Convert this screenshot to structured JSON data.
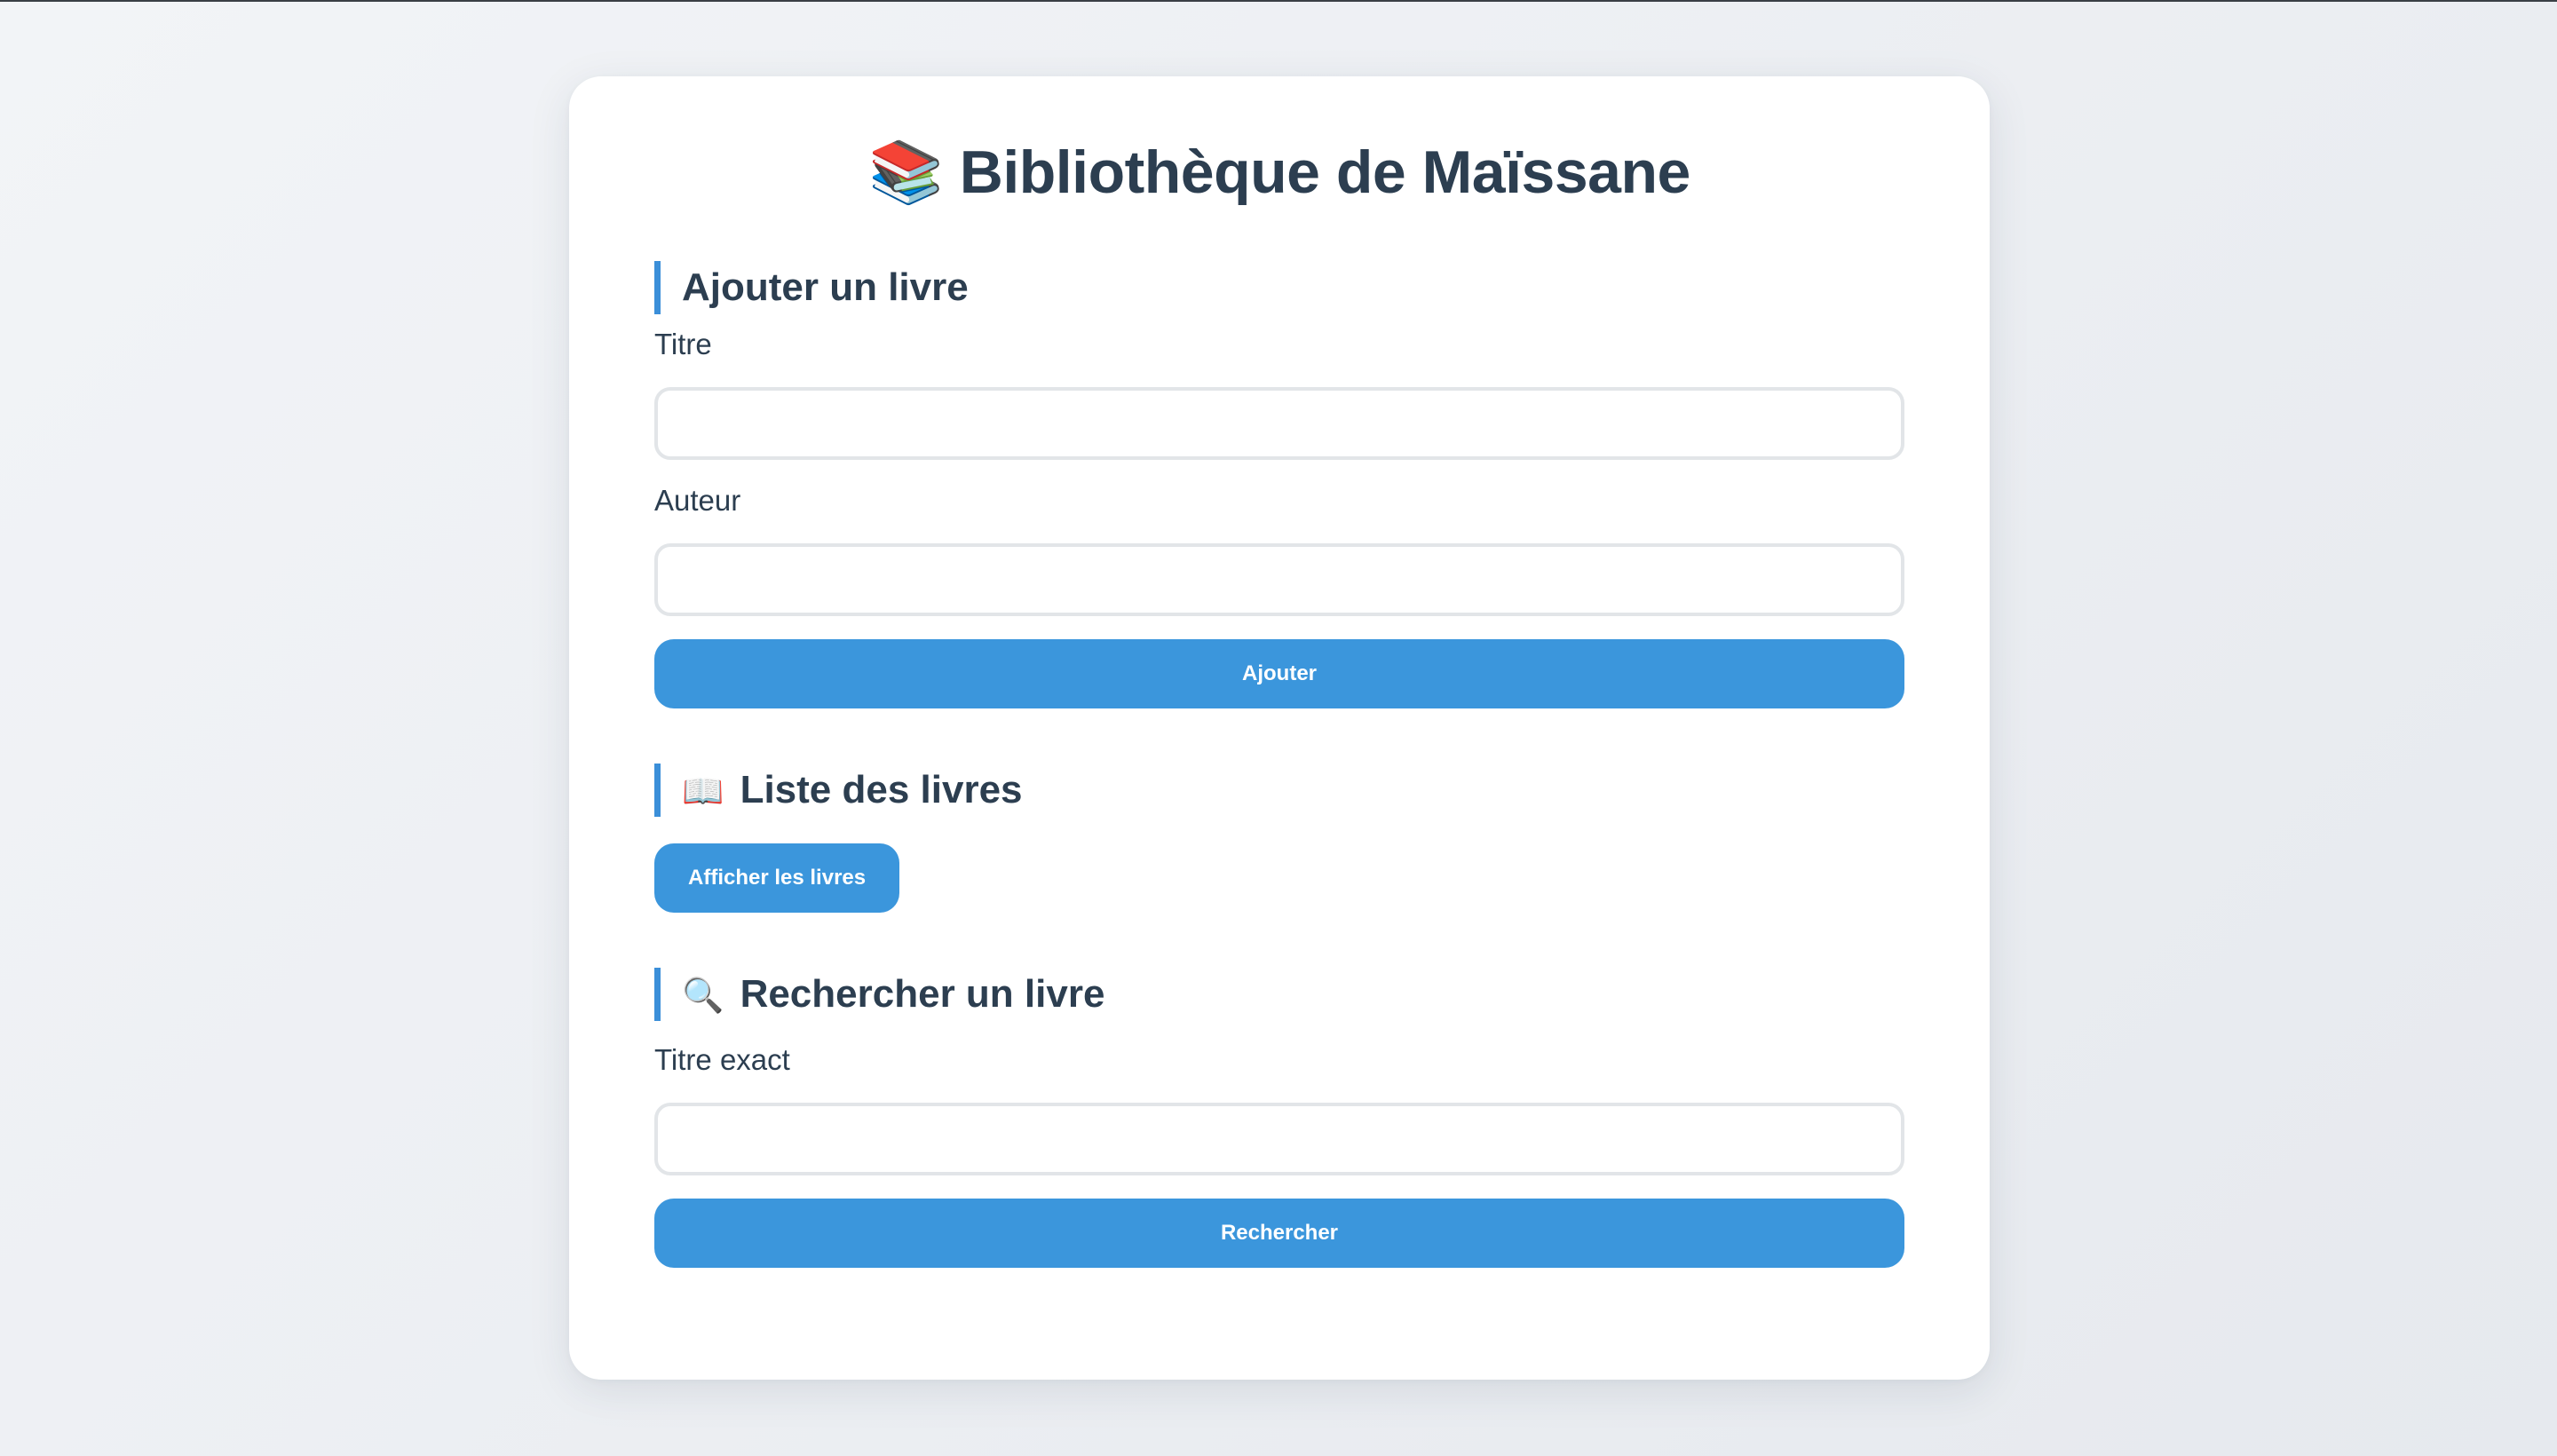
{
  "page": {
    "title": "Bibliothèque de Maïssane",
    "title_icon": "📚"
  },
  "add_book": {
    "heading": "Ajouter un livre",
    "title_label": "Titre",
    "title_value": "",
    "author_label": "Auteur",
    "author_value": "",
    "submit_label": "Ajouter"
  },
  "book_list": {
    "heading_icon": "📖",
    "heading": "Liste des livres",
    "show_label": "Afficher les livres"
  },
  "search": {
    "heading_icon": "🔍",
    "heading": "Rechercher un livre",
    "exact_title_label": "Titre exact",
    "exact_title_value": "",
    "submit_label": "Rechercher"
  },
  "colors": {
    "accent": "#3b96dc",
    "heading_bar": "#3b8fd9",
    "text": "#2c3e50",
    "card_background": "#ffffff",
    "page_background": "#eef0f4"
  }
}
